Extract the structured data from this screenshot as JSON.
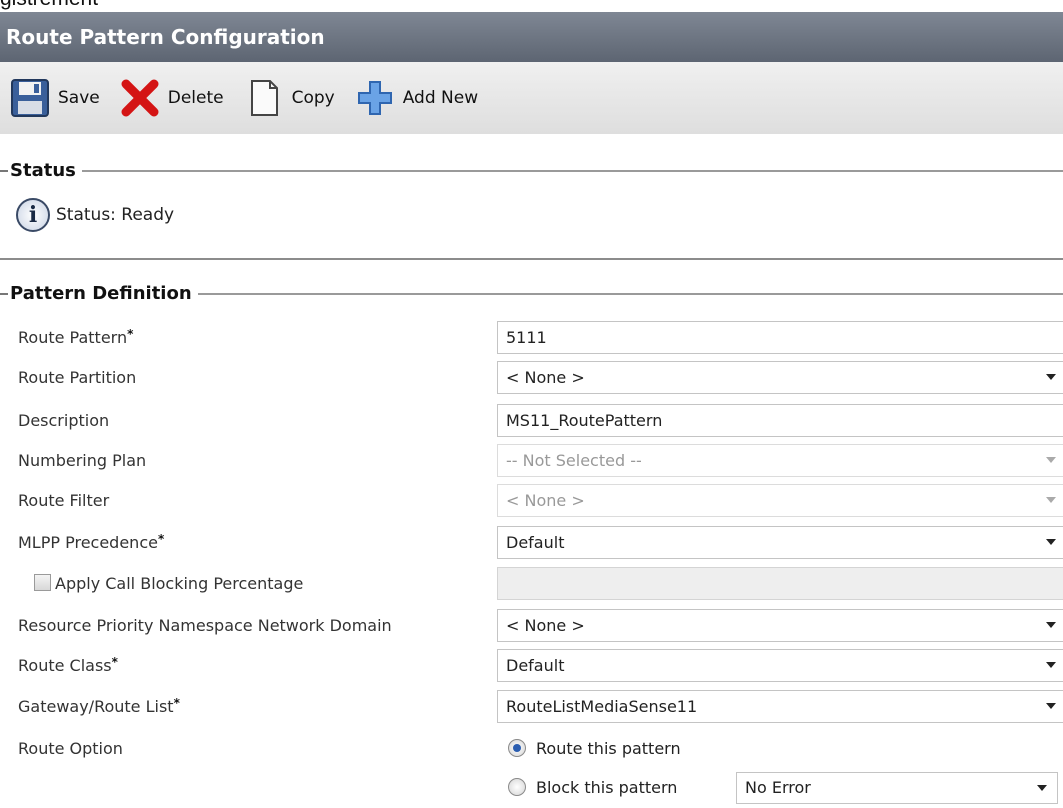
{
  "crop_text": "gistrement",
  "window": {
    "title": "Route Pattern Configuration"
  },
  "toolbar": {
    "save": "Save",
    "delete": "Delete",
    "copy": "Copy",
    "add_new": "Add New"
  },
  "status_section": {
    "title": "Status",
    "message": "Status: Ready"
  },
  "pattern_section": {
    "title": "Pattern Definition",
    "route_pattern": {
      "label": "Route Pattern",
      "value": "5111"
    },
    "route_partition": {
      "label": "Route Partition",
      "value": "< None >"
    },
    "description": {
      "label": "Description",
      "value": "MS11_RoutePattern"
    },
    "numbering_plan": {
      "label": "Numbering Plan",
      "value": "-- Not Selected --"
    },
    "route_filter": {
      "label": "Route Filter",
      "value": "< None >"
    },
    "mlpp_precedence": {
      "label": "MLPP Precedence",
      "value": "Default"
    },
    "call_blocking": {
      "label": "Apply Call Blocking Percentage",
      "checked": false,
      "value": ""
    },
    "resource_priority": {
      "label": "Resource Priority Namespace Network Domain",
      "value": "< None >"
    },
    "route_class": {
      "label": "Route Class",
      "value": "Default"
    },
    "gateway_route_list": {
      "label": "Gateway/Route List",
      "value": "RouteListMediaSense11"
    },
    "route_option": {
      "label": "Route Option",
      "route_this": "Route this pattern",
      "block_this": "Block this pattern",
      "selected": "route_this",
      "block_reason": "No Error"
    },
    "required_marker": "*"
  },
  "colors": {
    "titlebar": "#6b7380",
    "toolbar": "#e6e6e6",
    "delete_red": "#d41414",
    "add_blue": "#3a78c8"
  },
  "icons": [
    "save-icon",
    "delete-icon",
    "copy-icon",
    "add-new-icon",
    "info-icon"
  ]
}
